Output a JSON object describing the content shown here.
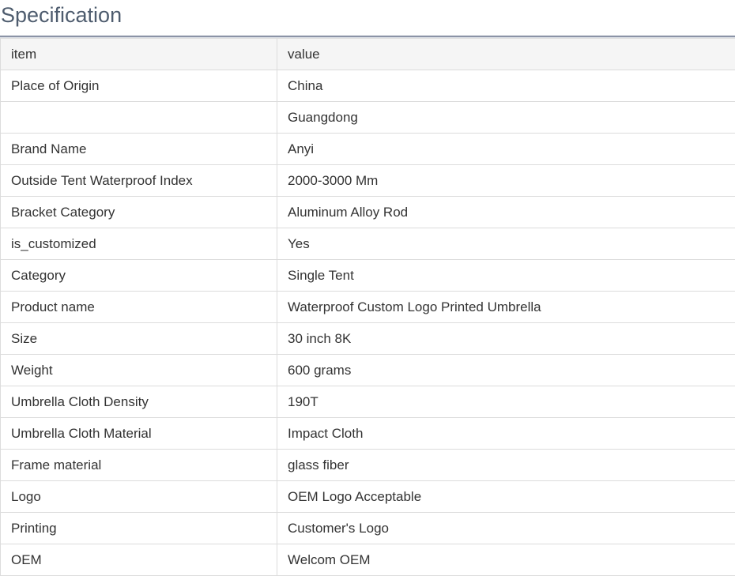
{
  "title": "Specification",
  "columns": [
    "item",
    "value"
  ],
  "rows": [
    {
      "item": "Place of Origin",
      "value": "China"
    },
    {
      "item": "",
      "value": "Guangdong"
    },
    {
      "item": "Brand Name",
      "value": "Anyi"
    },
    {
      "item": "Outside Tent Waterproof Index",
      "value": "2000-3000 Mm"
    },
    {
      "item": "Bracket Category",
      "value": "Aluminum Alloy Rod"
    },
    {
      "item": "is_customized",
      "value": "Yes"
    },
    {
      "item": "Category",
      "value": "Single Tent"
    },
    {
      "item": "Product name",
      "value": "Waterproof Custom Logo Printed Umbrella"
    },
    {
      "item": "Size",
      "value": "30 inch 8K"
    },
    {
      "item": "Weight",
      "value": "600 grams"
    },
    {
      "item": "Umbrella Cloth Density",
      "value": "190T"
    },
    {
      "item": "Umbrella Cloth Material",
      "value": "Impact Cloth"
    },
    {
      "item": "Frame material",
      "value": "glass fiber"
    },
    {
      "item": "Logo",
      "value": "OEM Logo Acceptable"
    },
    {
      "item": "Printing",
      "value": "Customer's Logo"
    },
    {
      "item": "OEM",
      "value": "Welcom OEM"
    }
  ]
}
